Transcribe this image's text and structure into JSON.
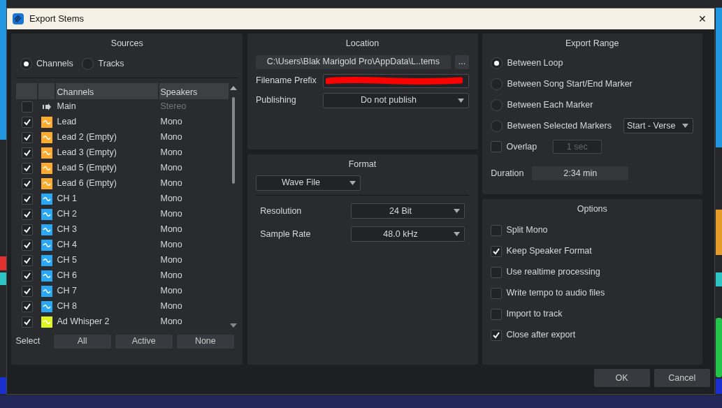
{
  "window": {
    "title": "Export Stems",
    "close": "✕"
  },
  "sources": {
    "title": "Sources",
    "modes": [
      {
        "label": "Channels",
        "selected": true
      },
      {
        "label": "Tracks",
        "selected": false
      }
    ],
    "columns": [
      "Channels",
      "Speakers"
    ],
    "rows": [
      {
        "name": "Main",
        "speakers": "Stereo",
        "checked": false,
        "kind": "output",
        "color": "#2a2b2f"
      },
      {
        "name": "Lead",
        "speakers": "Mono",
        "checked": true,
        "kind": "audio",
        "color": "#ffab2e"
      },
      {
        "name": "Lead 2 (Empty)",
        "speakers": "Mono",
        "checked": true,
        "kind": "audio",
        "color": "#ffab2e"
      },
      {
        "name": "Lead 3 (Empty)",
        "speakers": "Mono",
        "checked": true,
        "kind": "audio",
        "color": "#ffab2e"
      },
      {
        "name": "Lead 5 (Empty)",
        "speakers": "Mono",
        "checked": true,
        "kind": "audio",
        "color": "#ffab2e"
      },
      {
        "name": "Lead 6 (Empty)",
        "speakers": "Mono",
        "checked": true,
        "kind": "audio",
        "color": "#ffab2e"
      },
      {
        "name": "CH 1",
        "speakers": "Mono",
        "checked": true,
        "kind": "audio",
        "color": "#2aa8f5"
      },
      {
        "name": "CH 2",
        "speakers": "Mono",
        "checked": true,
        "kind": "audio",
        "color": "#2aa8f5"
      },
      {
        "name": "CH 3",
        "speakers": "Mono",
        "checked": true,
        "kind": "audio",
        "color": "#2aa8f5"
      },
      {
        "name": "CH 4",
        "speakers": "Mono",
        "checked": true,
        "kind": "audio",
        "color": "#2aa8f5"
      },
      {
        "name": "CH 5",
        "speakers": "Mono",
        "checked": true,
        "kind": "audio",
        "color": "#2aa8f5"
      },
      {
        "name": "CH 6",
        "speakers": "Mono",
        "checked": true,
        "kind": "audio",
        "color": "#2aa8f5"
      },
      {
        "name": "CH 7",
        "speakers": "Mono",
        "checked": true,
        "kind": "audio",
        "color": "#2aa8f5"
      },
      {
        "name": "CH 8",
        "speakers": "Mono",
        "checked": true,
        "kind": "audio",
        "color": "#2aa8f5"
      },
      {
        "name": "Ad Whisper 2",
        "speakers": "Mono",
        "checked": true,
        "kind": "audio",
        "color": "#e0f51e"
      }
    ],
    "select_label": "Select",
    "select_buttons": [
      "All",
      "Active",
      "None"
    ]
  },
  "location": {
    "title": "Location",
    "path": "C:\\Users\\Blak Marigold Pro\\AppData\\L..tems",
    "browse": "...",
    "prefix_label": "Filename Prefix",
    "publishing_label": "Publishing",
    "publishing": "Do not publish"
  },
  "format": {
    "title": "Format",
    "file_type": "Wave File",
    "resolution_label": "Resolution",
    "resolution": "24 Bit",
    "sample_rate_label": "Sample Rate",
    "sample_rate": "48.0 kHz"
  },
  "export_range": {
    "title": "Export Range",
    "options": [
      {
        "label": "Between Loop",
        "selected": true
      },
      {
        "label": "Between Song Start/End Marker",
        "selected": false
      },
      {
        "label": "Between Each Marker",
        "selected": false
      },
      {
        "label": "Between Selected Markers",
        "selected": false
      }
    ],
    "markers": "Start - Verse",
    "overlap": {
      "label": "Overlap",
      "checked": false,
      "value": "1 sec"
    },
    "duration_label": "Duration",
    "duration": "2:34 min"
  },
  "options": {
    "title": "Options",
    "items": [
      {
        "label": "Split Mono",
        "checked": false
      },
      {
        "label": "Keep Speaker Format",
        "checked": true
      },
      {
        "label": "Use realtime processing",
        "checked": false
      },
      {
        "label": "Write tempo to audio files",
        "checked": false
      },
      {
        "label": "Import to track",
        "checked": false
      },
      {
        "label": "Close after export",
        "checked": true
      }
    ]
  },
  "buttons": [
    "OK",
    "Cancel"
  ]
}
